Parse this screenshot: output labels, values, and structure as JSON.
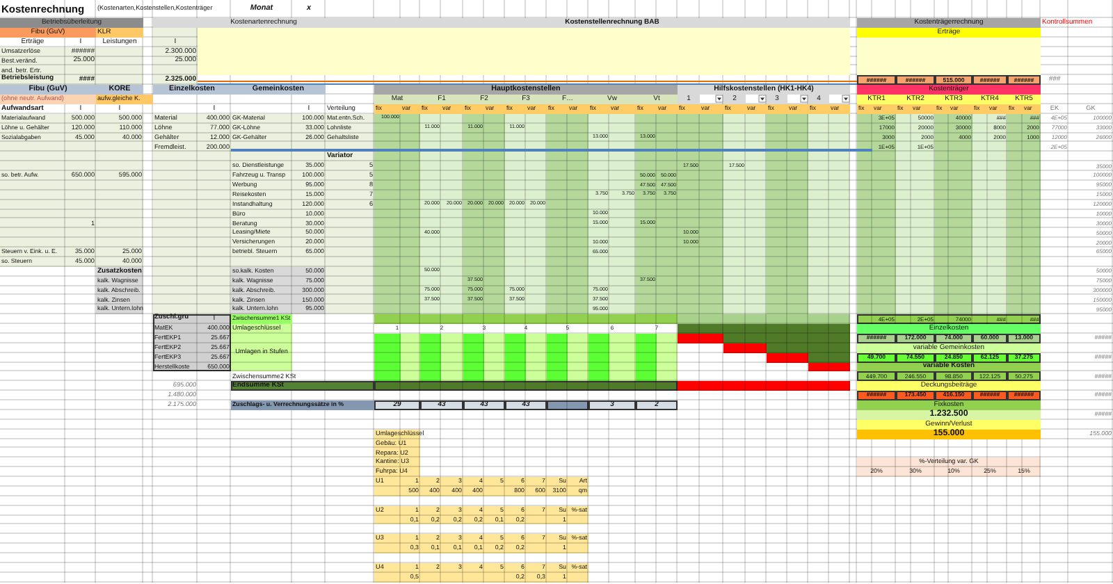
{
  "title": "Kostenrechnung",
  "subtitle": "(Kostenarten,Kostenstellen,Kostenträger",
  "month_label": "Monat",
  "month_value": "x",
  "betriebsueberleitung": {
    "title": "Betriebsüberleitung",
    "fibu": "Fibu (GuV)",
    "klr": "KLR",
    "columns": [
      "Erträge",
      "I",
      "Leistungen"
    ],
    "rows": [
      {
        "label": "Umsatzerlöse",
        "value": "######",
        "total": false
      },
      {
        "label": "Best.veränd.",
        "value": "25.000",
        "total": false
      },
      {
        "label": "and. betr. Ertr.",
        "total": false
      },
      {
        "label": "Betriebsleistung",
        "value": "####",
        "total": true
      }
    ]
  },
  "kostenartenrechnung": {
    "title": "Kostenartenrechnung",
    "column": "I",
    "values": [
      "2.300.000",
      "25.000"
    ],
    "total": "2.325.000"
  },
  "aufwand": {
    "fibu": "Fibu (GuV)",
    "kore": "KORE",
    "fibu_note": "(ohne neutr. Aufwand)",
    "kore_note": "aufw.gleiche K.",
    "header": "Aufwandsart",
    "columns": [
      "I",
      "I"
    ],
    "rows": [
      {
        "label": "Materialaufwand",
        "fibu": "500.000",
        "kore": "500.000"
      },
      {
        "label": "Löhne u. Gehälter",
        "fibu": "120.000",
        "kore": "110.000"
      },
      {
        "label": "Sozialabgaben",
        "fibu": "45.000",
        "kore": "40.000"
      },
      {
        "label": "so. betr. Aufw.",
        "fibu": "650.000",
        "kore": "595.000"
      },
      {
        "fibu": "1"
      },
      {
        "label": "Steuern v. Eink. u. E.",
        "fibu": "35.000",
        "kore": "25.000"
      },
      {
        "label": "so. Steuern",
        "fibu": "45.000",
        "kore": "40.000"
      }
    ]
  },
  "zusatzkosten": {
    "title": "Zusatzkosten",
    "items": [
      "kalk. Wagnisse",
      "kalk. Abschreib.",
      "kalk. Zinsen",
      "kalk. Untern.lohn"
    ]
  },
  "einzelkosten": {
    "title": "Einzelkosten",
    "column": "I",
    "rows": [
      {
        "label": "Material",
        "value": "400.000"
      },
      {
        "label": "Löhne",
        "value": "77.000"
      },
      {
        "label": "Gehälter",
        "value": "12.000"
      },
      {
        "label": "Fremdleist.",
        "value": "200.000"
      }
    ]
  },
  "gemeinkosten": {
    "title": "Gemeinkosten",
    "column": "I",
    "distribution": "Verteilung",
    "variator": "Variator",
    "rows": [
      {
        "label": "GK-Material",
        "value": "100.000",
        "basis": "Mat.entn.Sch.",
        "bab": {
          "0": "100.000"
        }
      },
      {
        "label": "GK-Löhne",
        "value": "33.000",
        "basis": "Lohnliste",
        "bab": {
          "2": "11.000",
          "4": "11.000",
          "6": "11.000"
        }
      },
      {
        "label": "GK-Gehälter",
        "value": "26.000",
        "basis": "Gehaltsliste",
        "bab": {
          "10": "13.000",
          "12": "13.000"
        }
      },
      {
        "label": "so. Dienstleistunge",
        "value": "35.000",
        "variator": "5",
        "bab": {
          "14": "17.500",
          "16": "17.500"
        }
      },
      {
        "label": "Fahrzeug u. Transp",
        "value": "100.000",
        "variator": "5",
        "bab": {
          "12": "50.000",
          "13": "50.000"
        }
      },
      {
        "label": "Werbung",
        "value": "95.000",
        "variator": "8",
        "bab": {
          "12": "47.500",
          "13": "47.500"
        }
      },
      {
        "label": "Reisekosten",
        "value": "15.000",
        "variator": "7",
        "bab": {
          "10": "3.750",
          "11": "3.750",
          "12": "3.750",
          "13": "3.750"
        }
      },
      {
        "label": "Instandhaltung",
        "value": "120.000",
        "variator": "6",
        "bab": {
          "2": "20.000",
          "3": "20.000",
          "4": "20.000",
          "5": "20.000",
          "6": "20.000",
          "7": "20.000"
        }
      },
      {
        "label": "Büro",
        "value": "10.000",
        "bab": {
          "10": "10.000"
        }
      },
      {
        "label": "Beratung",
        "value": "30.000",
        "bab": {
          "10": "15.000",
          "12": "15.000"
        }
      },
      {
        "label": "Leasing/Miete",
        "value": "50.000",
        "bab": {
          "2": "40.000",
          "14": "10.000"
        }
      },
      {
        "label": "Versicherungen",
        "value": "20.000",
        "bab": {
          "10": "10.000",
          "14": "10.000"
        }
      },
      {
        "label": "betriebl. Steuern",
        "value": "65.000",
        "bab": {
          "10": "65.000"
        }
      },
      {
        "label": "so.kalk. Kosten",
        "value": "50.000",
        "bab": {
          "2": "50.000"
        }
      },
      {
        "label": "kalk. Wagnisse",
        "value": "75.000",
        "bab": {
          "4": "37.500",
          "12": "37.500"
        }
      },
      {
        "label": "kalk. Abschreib.",
        "value": "300.000",
        "bab": {
          "2": "75.000",
          "4": "75.000",
          "6": "75.000",
          "10": "75.000"
        }
      },
      {
        "label": "kalk. Zinsen",
        "value": "150.000",
        "bab": {
          "2": "37.500",
          "4": "37.500",
          "6": "37.500",
          "10": "37.500"
        }
      },
      {
        "label": "kalk. Untern.lohn",
        "value": "95.000",
        "bab": {
          "10": "95.000"
        }
      }
    ]
  },
  "surcharge_base": {
    "title": "Zuschl.gru",
    "column": "I",
    "rows": [
      {
        "label": "MatEK",
        "value": "400.000"
      },
      {
        "label": "FertEKP1",
        "value": "25.667"
      },
      {
        "label": "FertEKP2",
        "value": "25.667"
      },
      {
        "label": "FertEKP3",
        "value": "25.667"
      },
      {
        "label": "Herstellkoste",
        "value": "650.000"
      }
    ],
    "totals": [
      "695.000",
      "1.480.000",
      "2.175.000"
    ]
  },
  "bab": {
    "title": "Kostenstellenrechnung BAB",
    "main_title": "Hauptkostenstellen",
    "main": [
      {
        "name": "Mat",
        "parts": [
          "fix",
          "var"
        ]
      },
      {
        "name": "F1",
        "parts": [
          "fix",
          "var"
        ]
      },
      {
        "name": "F2",
        "parts": [
          "fix",
          "var"
        ]
      },
      {
        "name": "F3",
        "parts": [
          "fix",
          "var"
        ]
      },
      {
        "name": "F…",
        "parts": [
          "fix",
          "var"
        ]
      },
      {
        "name": "Vw",
        "parts": [
          "fix",
          "var"
        ]
      },
      {
        "name": "Vt",
        "parts": [
          "fix",
          "var"
        ]
      }
    ],
    "aux_title": "Hilfskostenstellen (HK1-HK4)",
    "aux": [
      {
        "name": "1",
        "parts": [
          "fix",
          "var"
        ]
      },
      {
        "name": "2",
        "parts": [
          "fix",
          "var"
        ]
      },
      {
        "name": "3",
        "parts": [
          "fix",
          "var"
        ]
      },
      {
        "name": "4",
        "parts": [
          "fix",
          "var"
        ]
      }
    ],
    "subtotal1": "Zwischensumme1 KSt",
    "allocation_key": "Umlageschlüssel",
    "allocations": "Umlagen in Stufen",
    "subtotal2": "Zwischensumme2 KSt",
    "total": "Endsumme KSt",
    "rates_title": "Zuschlags- u. Verrechnungssätze in %",
    "key_numbers": [
      "1",
      "2",
      "3",
      "4",
      "5",
      "6",
      "7"
    ],
    "rates": {
      "0": "29",
      "1": "43",
      "2": "43",
      "3": "43",
      "5": "3",
      "6": "2"
    }
  },
  "ktr": {
    "title": "Kostenträgerrechnung",
    "revenue": "Erträge",
    "revenue_values": [
      "######",
      "######",
      "515.000",
      "######",
      "######"
    ],
    "check": "###",
    "carriers_title": "Kostenträger",
    "carriers": [
      {
        "name": "KTR1",
        "parts": [
          "fix",
          "var"
        ]
      },
      {
        "name": "KTR2",
        "parts": [
          "fix",
          "var"
        ]
      },
      {
        "name": "KTR3",
        "parts": [
          "fix",
          "var"
        ]
      },
      {
        "name": "KTR4",
        "parts": [
          "fix",
          "var"
        ]
      },
      {
        "name": "KTR5",
        "parts": [
          "fix",
          "var"
        ]
      }
    ],
    "cost_rows": [
      [
        "3E+05",
        "50000",
        "40000",
        "###",
        "###"
      ],
      [
        "17000",
        "20000",
        "30000",
        "8000",
        "2000"
      ],
      [
        "3000",
        "2000",
        "4000",
        "2000",
        "1000"
      ],
      [
        "1E+05",
        "1E+05"
      ]
    ],
    "total_row": [
      "4E+05",
      "2E+05",
      "74000",
      "###",
      "###"
    ],
    "sections": [
      {
        "kind": "direct",
        "title": "Einzelkosten",
        "values": [
          "######",
          "172.000",
          "74.000",
          "60.000",
          "13.000"
        ]
      },
      {
        "kind": "overhead",
        "title": "variable Gemeinkosten",
        "values": [
          "49.700",
          "74.550",
          "24.850",
          "62.125",
          "37.275"
        ]
      },
      {
        "kind": "variable",
        "title": "variable Kosten",
        "values": [
          "449.700",
          "246.550",
          "98.850",
          "122.125",
          "50.275"
        ]
      },
      {
        "kind": "margin",
        "title": "Deckungsbeiträge",
        "values": [
          "######",
          "173.450",
          "416.150",
          "######",
          "######"
        ]
      }
    ],
    "fixed_title": "Fixkosten",
    "fixed": "1.232.500",
    "result_title": "Gewinn/Verlust",
    "result": "155.000",
    "share_title": "%-Verteilung var. GK",
    "shares": [
      "20%",
      "30%",
      "10%",
      "25%",
      "15%"
    ]
  },
  "controls": {
    "title": "Kontrollsummen",
    "ek_label": "EK",
    "gk_label": "GK",
    "ek": [
      "4E+05",
      "77000",
      "12000",
      "2E+05"
    ],
    "gk": [
      "100000",
      "33000",
      "26000",
      "35000",
      "100000",
      "95000",
      "15000",
      "120000",
      "10000",
      "30000",
      "50000",
      "20000",
      "65000",
      "50000",
      "75000",
      "300000",
      "150000",
      "95000"
    ],
    "checks": [
      "#####",
      "#####",
      "#####",
      "#####",
      "#####"
    ],
    "result": "155.000"
  },
  "umlage": {
    "title": "Umlageschlüssel",
    "keys": [
      "Gebäu: U1",
      "Repara: U2",
      "Kantine: U3",
      "Fuhrpa: U4"
    ],
    "tables": [
      {
        "name": "U1",
        "headers": [
          "1",
          "2",
          "3",
          "4",
          "5",
          "6",
          "7",
          "Su",
          "Art"
        ],
        "values": {
          "0": "500",
          "1": "400",
          "2": "400",
          "3": "400",
          "5": "800",
          "6": "600",
          "7": "3100",
          "8": "qm"
        }
      },
      {
        "name": "U2",
        "headers": [
          "1",
          "2",
          "3",
          "4",
          "5",
          "6",
          "7",
          "Su",
          "%-sat"
        ],
        "values": {
          "0": "0,1",
          "1": "0,2",
          "2": "0,2",
          "3": "0,2",
          "4": "0,1",
          "5": "0,2",
          "7": "1"
        }
      },
      {
        "name": "U3",
        "headers": [
          "1",
          "2",
          "3",
          "4",
          "5",
          "6",
          "7",
          "Su",
          "%-sat"
        ],
        "values": {
          "0": "0,3",
          "1": "0,1",
          "2": "0,1",
          "3": "0,1",
          "4": "0,2",
          "5": "0,2",
          "7": "1"
        }
      },
      {
        "name": "U4",
        "headers": [
          "1",
          "2",
          "3",
          "4",
          "5",
          "6",
          "7",
          "Su",
          "%-sat"
        ],
        "values": {
          "0": "0,5",
          "5": "0,2",
          "6": "0,3",
          "7": "1"
        }
      }
    ]
  }
}
